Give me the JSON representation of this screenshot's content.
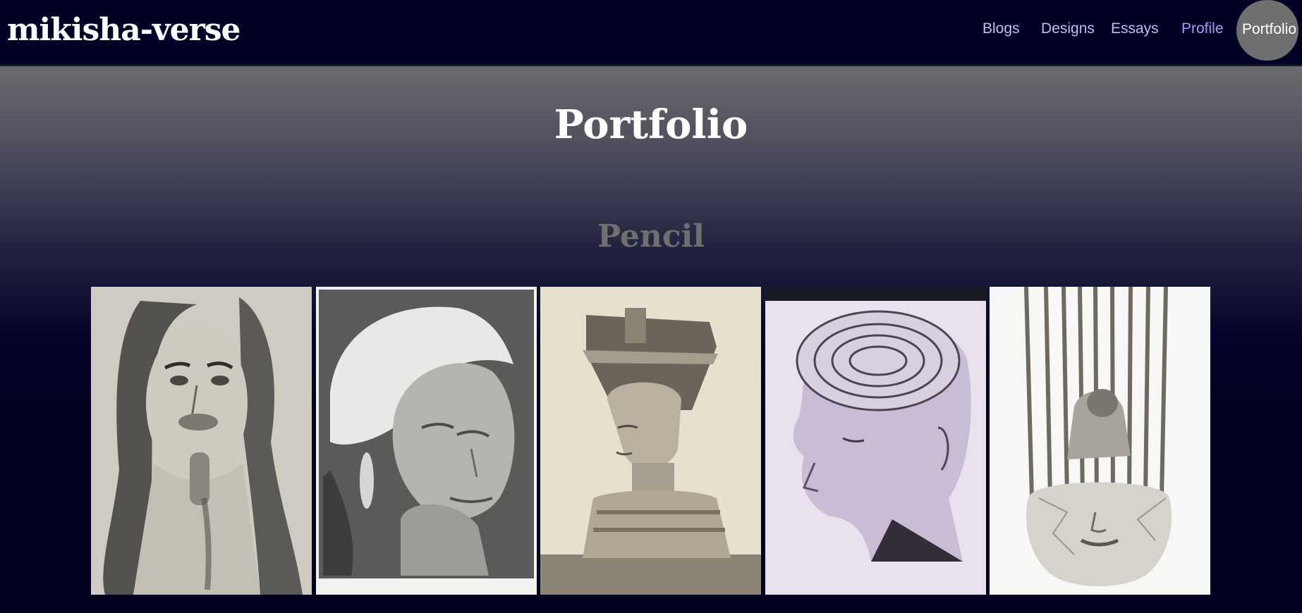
{
  "header": {
    "brand": "mikisha-verse",
    "nav": {
      "blogs": "Blogs",
      "designs": "Designs",
      "essays": "Essays",
      "profile": "Profile",
      "portfolio": "Portfolio"
    },
    "active": "Portfolio"
  },
  "main": {
    "title": "Portfolio",
    "section_title": "Pencil",
    "gallery": [
      {
        "subject": "pencil portrait of woman with long hair and hand tattoo"
      },
      {
        "subject": "pencil portrait of elderly woman with headscarf and earring"
      },
      {
        "subject": "pencil drawing of Nefertiti bust"
      },
      {
        "subject": "pencil drawing of head with maze brain"
      },
      {
        "subject": "pencil drawing of figure caged by bars over face"
      }
    ]
  },
  "colors": {
    "header_bg": "#010126",
    "nav_link": "#c8b8f4",
    "active_pill": "#6f6f6f",
    "section_title": "#6f6f6f",
    "page_bg": "#01011f"
  }
}
